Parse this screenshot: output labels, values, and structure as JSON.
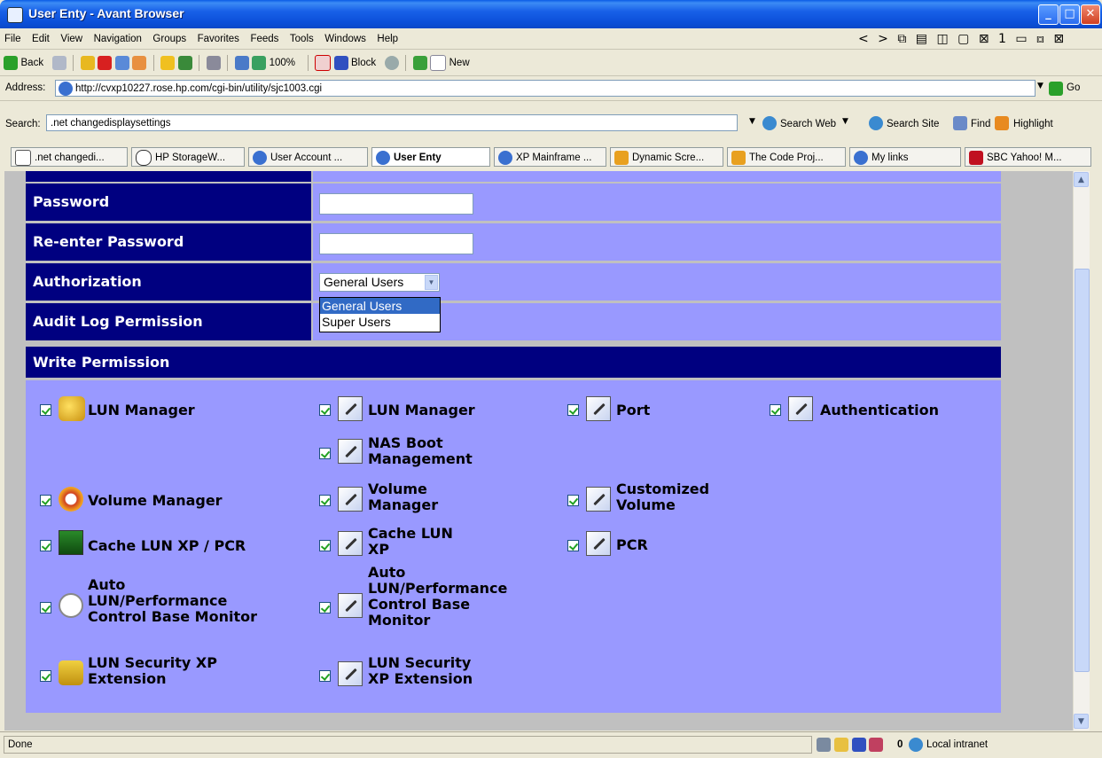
{
  "window": {
    "title": "User Enty - Avant Browser"
  },
  "menu": [
    "File",
    "Edit",
    "View",
    "Navigation",
    "Groups",
    "Favorites",
    "Feeds",
    "Tools",
    "Windows",
    "Help"
  ],
  "menu_right_glyphs": "< > ⧉ ▤ ◫ ▢ ⊠ 1 ▭ ⧈ ⊠",
  "toolbar": {
    "back": "Back",
    "zoom": "100%",
    "block": "Block",
    "new": "New"
  },
  "address": {
    "label": "Address:",
    "url": "http://cvxp10227.rose.hp.com/cgi-bin/utility/sjc1003.cgi",
    "go": "Go"
  },
  "search": {
    "label": "Search:",
    "value": ".net changedisplaysettings",
    "web": "Search Web",
    "site": "Search Site",
    "find": "Find",
    "highlight": "Highlight"
  },
  "tabs": [
    ".net changedi...",
    "HP StorageW...",
    "User Account ...",
    "User Enty",
    "XP Mainframe ...",
    "Dynamic Scre...",
    "The Code Proj...",
    "My links",
    "SBC Yahoo! M..."
  ],
  "form": {
    "password": "Password",
    "reenter": "Re-enter Password",
    "authorization": "Authorization",
    "authorization_selected": "General Users",
    "authorization_options": [
      "General Users",
      "Super Users"
    ],
    "audit": "Audit Log Permission",
    "write_permission": "Write Permission"
  },
  "permissions": {
    "col1": [
      "LUN Manager",
      "Volume Manager",
      "Cache LUN XP / PCR",
      "Auto\nLUN/Performance\nControl Base Monitor",
      "LUN Security XP\nExtension"
    ],
    "col2": [
      "LUN Manager",
      "NAS Boot\nManagement",
      "Volume\nManager",
      "Cache LUN\nXP",
      "Auto\nLUN/Performance\nControl Base\nMonitor",
      "LUN Security\nXP Extension"
    ],
    "col3": [
      "Port",
      "Customized\nVolume",
      "PCR"
    ],
    "col4": [
      "Authentication"
    ]
  },
  "status": {
    "text": "Done",
    "count": "0",
    "zone": "Local intranet"
  },
  "colors": {
    "label_bg": "#000080",
    "value_bg": "#9999ff",
    "titlebar": "#0b4fd8"
  }
}
